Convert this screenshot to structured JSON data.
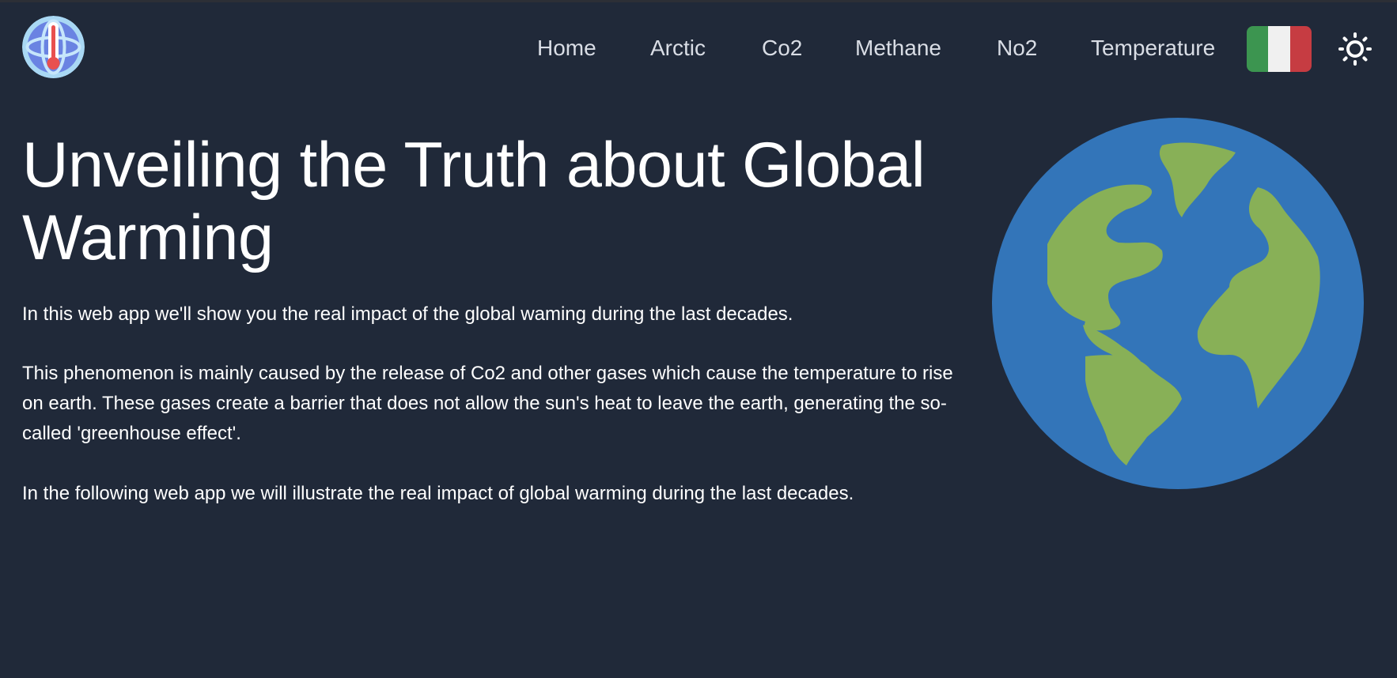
{
  "header": {
    "logo_icon": "thermometer-globe-icon",
    "nav": [
      {
        "label": "Home"
      },
      {
        "label": "Arctic"
      },
      {
        "label": "Co2"
      },
      {
        "label": "Methane"
      },
      {
        "label": "No2"
      },
      {
        "label": "Temperature"
      }
    ],
    "language_flag": {
      "icon": "italy-flag-icon",
      "colors": [
        "#3c9550",
        "#f0f0f0",
        "#c63c42"
      ]
    },
    "theme_toggle_icon": "sun-icon"
  },
  "hero": {
    "title": "Unveiling the Truth about Global Warming",
    "paragraphs": [
      "In this web app we'll show you the real impact of the global waming during the last decades.",
      "This phenomenon is mainly caused by the release of Co2 and other gases which cause the temperature to rise on earth. These gases create a barrier that does not allow the sun's heat to leave the earth, generating the so-called 'greenhouse effect'.",
      "In the following web app we will illustrate the real impact of global warming during the last decades."
    ],
    "image_icon": "earth-globe-icon"
  },
  "colors": {
    "background": "#202939",
    "text": "#ffffff",
    "nav_text": "#d9dde5",
    "ocean": "#3375b9",
    "land": "#88b057"
  }
}
